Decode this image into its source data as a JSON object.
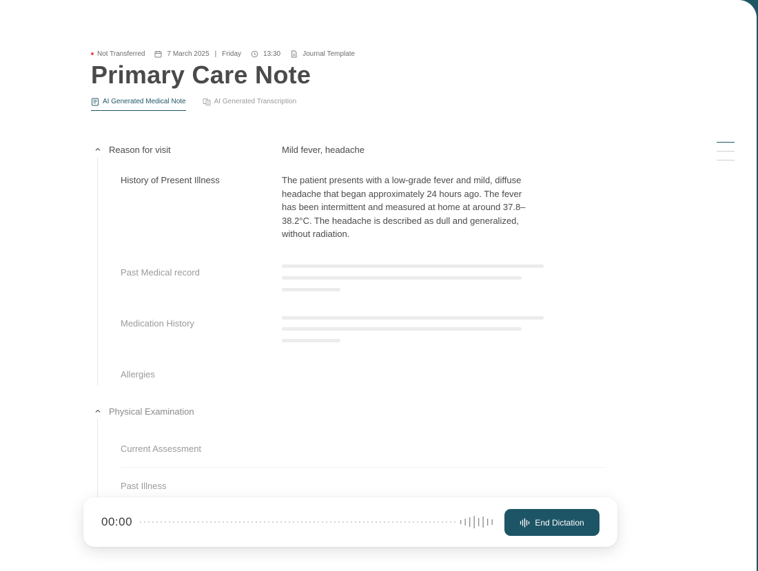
{
  "header": {
    "status": "Not Transferred",
    "date": "7 March 2025",
    "separator": "|",
    "weekday": "Friday",
    "time": "13:30",
    "template": "Journal Template"
  },
  "title": "Primary Care Note",
  "tabs": [
    {
      "label": "AI Generated Medical Note",
      "active": true
    },
    {
      "label": "AI Generated Transcription",
      "active": false
    }
  ],
  "sections": {
    "reason": {
      "label": "Reason for visit",
      "value": "Mild fever, headache",
      "fields": [
        {
          "label": "History of Present Illness",
          "value": "The patient presents with a low-grade fever and mild, diffuse headache that began approximately 24 hours ago. The fever has been intermittent and measured at home at around 37.8–38.2°C. The headache is described as dull and generalized, without radiation."
        },
        {
          "label": "Past Medical record"
        },
        {
          "label": "Medication History"
        },
        {
          "label": "Allergies"
        }
      ]
    },
    "exam": {
      "label": "Physical Examination",
      "fields": [
        {
          "label": "Current Assessment"
        },
        {
          "label": "Past Illness"
        }
      ]
    }
  },
  "dictation": {
    "timer": "00:00",
    "button_label": "End Dictation"
  },
  "colors": {
    "accent": "#1e5566",
    "status_dot": "#e5534b",
    "text": "#4a4a4a",
    "muted": "#9a9a9a"
  },
  "icons": {
    "status": "status-dot",
    "date": "calendar-icon",
    "time": "clock-icon",
    "template": "document-icon",
    "tab_note": "note-icon",
    "tab_transcription": "transcription-icon",
    "section_toggle": "chevron-up-icon",
    "outline": "outline-menu-icon",
    "end_dictation": "waveform-icon"
  }
}
